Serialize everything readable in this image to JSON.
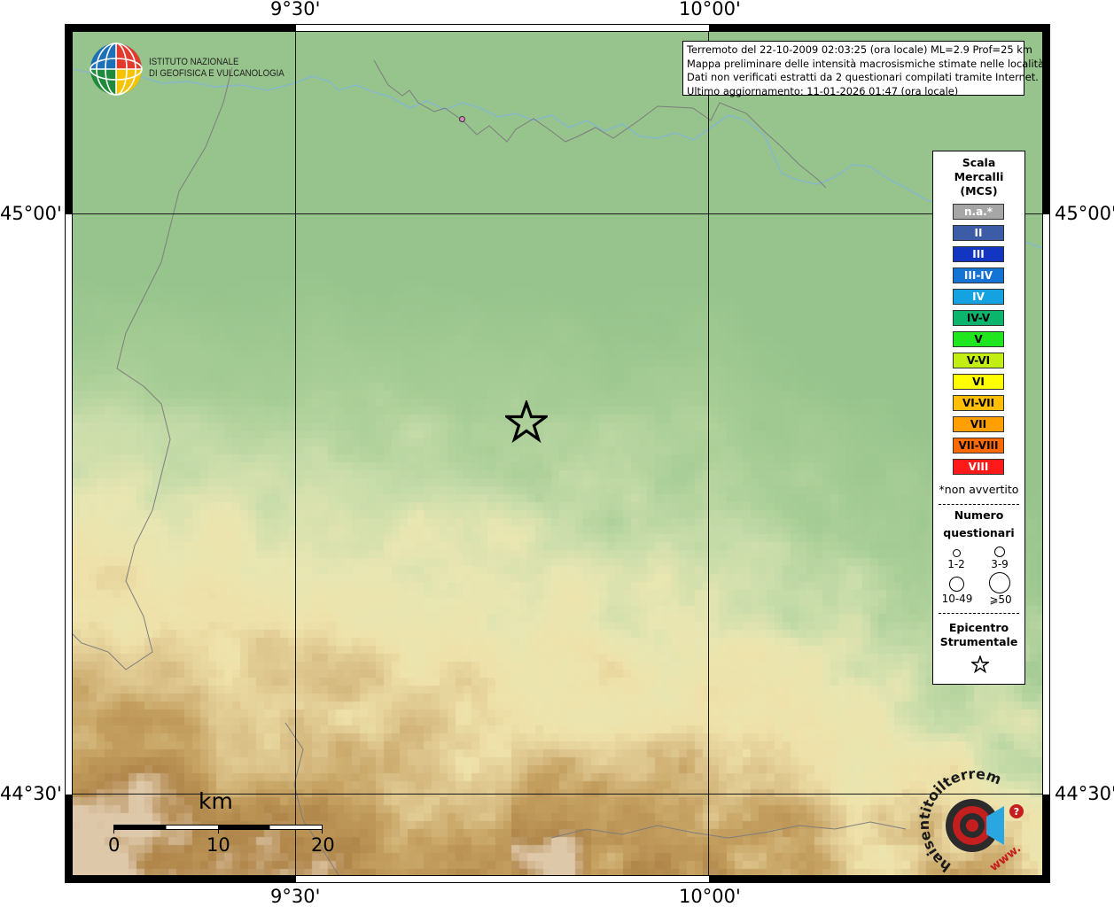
{
  "header": {
    "line1": "Terremoto del 22-10-2009 02:03:25 (ora locale) ML=2.9 Prof=25 km",
    "line2": "Mappa preliminare delle intensità macrosismiche stimate nelle località",
    "line3": "Dati non verificati estratti da 2 questionari compilati tramite Internet.",
    "line4": "Ultimo aggiornamento: 11-01-2026 01:47 (ora locale)"
  },
  "axes": {
    "lon_top_left": "9°30'",
    "lon_top_right": "10°00'",
    "lon_bottom_left": "9°30'",
    "lon_bottom_right": "10°00'",
    "lat_upper_left": "45°00'",
    "lat_upper_right": "45°00'",
    "lat_lower_left": "44°30'",
    "lat_lower_right": "44°30'"
  },
  "logo": {
    "line1": "ISTITUTO NAZIONALE",
    "line2": "DI GEOFISICA E VULCANOLOGIA"
  },
  "legend": {
    "title1": "Scala",
    "title2": "Mercalli",
    "title3": "(MCS)",
    "classes": [
      {
        "label": "n.a.*",
        "color": "#a6a6a6"
      },
      {
        "label": "II",
        "color": "#3d5ca8"
      },
      {
        "label": "III",
        "color": "#1236c2"
      },
      {
        "label": "III-IV",
        "color": "#1573d6"
      },
      {
        "label": "IV",
        "color": "#14a2e0"
      },
      {
        "label": "IV-V",
        "color": "#0bb56c"
      },
      {
        "label": "V",
        "color": "#1fe61f"
      },
      {
        "label": "V-VI",
        "color": "#c2ee13"
      },
      {
        "label": "VI",
        "color": "#ffff00"
      },
      {
        "label": "VI-VII",
        "color": "#ffbf00"
      },
      {
        "label": "VII",
        "color": "#ff9f00"
      },
      {
        "label": "VII-VIII",
        "color": "#ff6a00"
      },
      {
        "label": "VIII",
        "color": "#ff1a1a"
      }
    ],
    "note": "*non avvertito",
    "questionari_title1": "Numero",
    "questionari_title2": "questionari",
    "q_labels": [
      "1-2",
      "3-9",
      "10-49",
      "⩾50"
    ],
    "epicentro1": "Epicentro",
    "epicentro2": "Strumentale"
  },
  "scalebar": {
    "unit": "km",
    "ticks": [
      "0",
      "10",
      "20"
    ]
  },
  "brand": {
    "text": "haisentitoilterremoto.it",
    "url": "www."
  },
  "colors": {
    "plain_green": "#8fc28f",
    "hill_cream": "#e9e6ad",
    "mountain_brown": "#b8904a",
    "river": "#7fb7d8",
    "border": "#7d7d7d"
  }
}
